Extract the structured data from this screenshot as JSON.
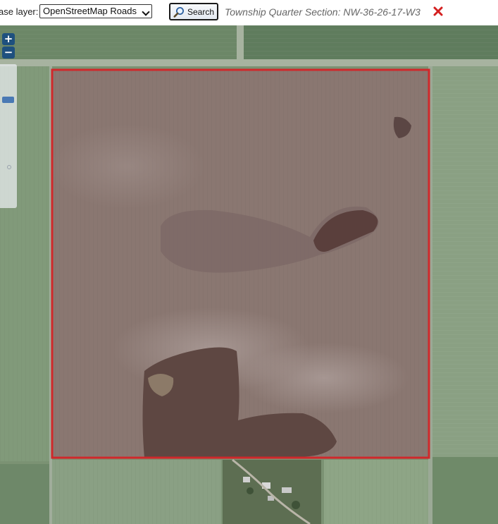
{
  "toolbar": {
    "base_layer_label": "ase layer:",
    "base_layer_value": "OpenStreetMap Roads",
    "search_label": "Search",
    "quarter_section_text": "Township Quarter Section: NW-36-26-17-W3"
  },
  "icons": {
    "search": "magnifier-icon",
    "close": "red-x-icon",
    "dropdown": "chevron-down-icon"
  },
  "map": {
    "zoom_in_label": "+",
    "zoom_out_label": "−",
    "highlight_color": "#d0282b",
    "view": "satellite imagery of farmland with highlighted quarter section"
  }
}
